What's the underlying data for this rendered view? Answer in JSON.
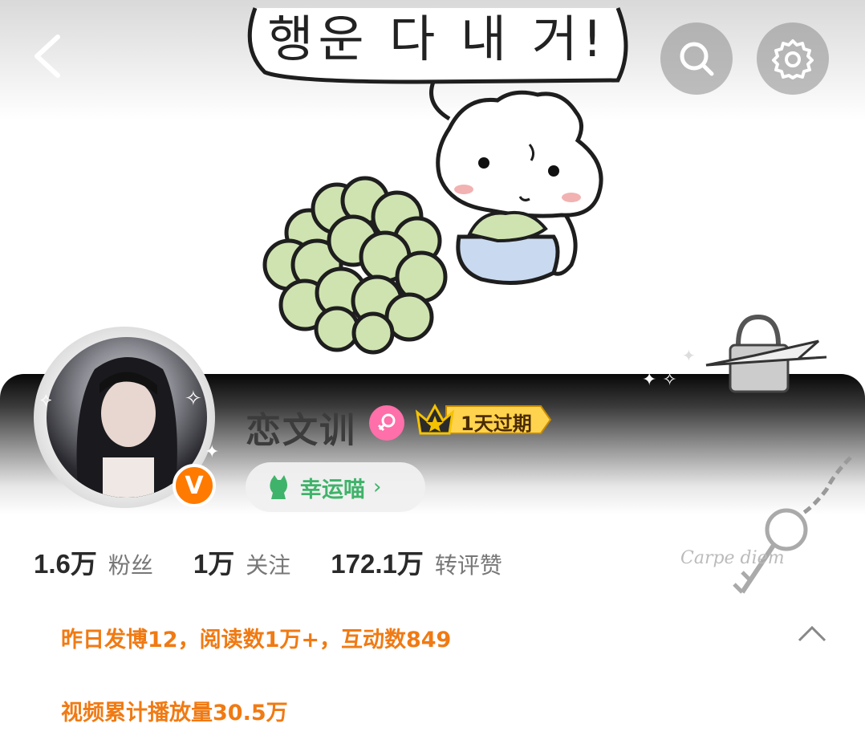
{
  "banner": {
    "speech_text": "행운 다 내 거!",
    "icons": [
      "back-arrow-icon",
      "search-icon",
      "gear-icon"
    ]
  },
  "profile": {
    "username": "恋文训",
    "gender": "female",
    "vip_badge_text": "1天过期",
    "verified_letter": "V",
    "lucky_label": "幸运喵",
    "lucky_chevron": "›"
  },
  "stats": [
    {
      "value": "1.6万",
      "label": "粉丝"
    },
    {
      "value": "1万",
      "label": "关注"
    },
    {
      "value": "172.1万",
      "label": "转评赞"
    }
  ],
  "info": {
    "line1": "昨日发博12，阅读数1万+，互动数849",
    "line2": "视频累计播放量30.5万"
  },
  "decor_text": "Carpe diem",
  "colors": {
    "accent_orange": "#f07a13",
    "lucky_green": "#3fb36a",
    "gender_pink": "#ff6fa9",
    "verify_orange": "#ff7a00"
  }
}
